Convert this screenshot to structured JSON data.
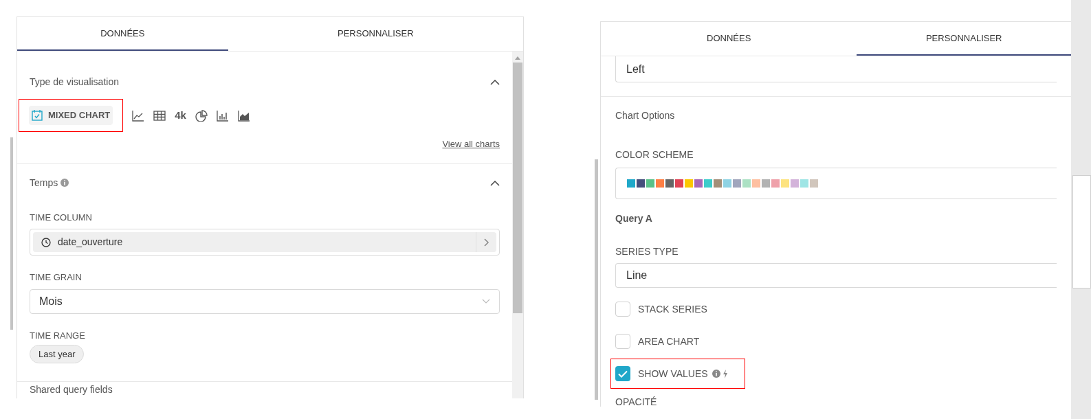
{
  "left_panel": {
    "tabs": [
      {
        "label": "DONNÉES",
        "selected": true
      },
      {
        "label": "PERSONNALISER",
        "selected": false
      }
    ],
    "visualization": {
      "title": "Type de visualisation",
      "expanded": true,
      "chart_types": [
        {
          "kind": "mixed",
          "label": "MIXED CHART",
          "selected": true,
          "highlighted": true
        },
        {
          "kind": "line",
          "selected": false,
          "highlighted": false
        },
        {
          "kind": "table",
          "selected": false,
          "highlighted": false
        },
        {
          "kind": "big_number",
          "label": "4k",
          "selected": false,
          "highlighted": false
        },
        {
          "kind": "pie",
          "selected": false,
          "highlighted": false
        },
        {
          "kind": "bar",
          "selected": false,
          "highlighted": false
        },
        {
          "kind": "area",
          "selected": false,
          "highlighted": false
        }
      ],
      "link": "View all charts"
    },
    "time": {
      "title": "Temps",
      "expanded": true,
      "time_column_label": "TIME COLUMN",
      "time_column": "date_ouverture",
      "time_grain_label": "TIME GRAIN",
      "time_grain": "Mois",
      "time_range_label": "TIME RANGE",
      "time_range": "Last year"
    },
    "next_section": "Shared query fields"
  },
  "right_panel": {
    "tabs": [
      {
        "label": "DONNÉES",
        "selected": false
      },
      {
        "label": "PERSONNALISER",
        "selected": true
      }
    ],
    "previous_value": "Left",
    "section_title": "Chart Options",
    "color_scheme_label": "COLOR SCHEME",
    "color_scheme": [
      {
        "color": "#1fa8c9"
      },
      {
        "color": "#454e7c"
      },
      {
        "color": "#5ac189"
      },
      {
        "color": "#ff7f44"
      },
      {
        "color": "#666666"
      },
      {
        "color": "#e04355"
      },
      {
        "color": "#fcc700"
      },
      {
        "color": "#a868b7"
      },
      {
        "color": "#3ccccb"
      },
      {
        "color": "#a38f79"
      },
      {
        "color": "#8fd3e4"
      },
      {
        "color": "#a1a6bd"
      },
      {
        "color": "#acE1c4"
      },
      {
        "color": "#fec0a1"
      },
      {
        "color": "#b2b2b2"
      },
      {
        "color": "#efa1aa"
      },
      {
        "color": "#fde380"
      },
      {
        "color": "#d3b3da"
      },
      {
        "color": "#9ee5e5"
      },
      {
        "color": "#d1c6bc"
      }
    ],
    "query_title": "Query A",
    "series_type_label": "SERIES TYPE",
    "series_type": "Line",
    "options": [
      {
        "label": "STACK SERIES",
        "checked": false,
        "highlighted": false,
        "info": false
      },
      {
        "label": "AREA CHART",
        "checked": false,
        "highlighted": false,
        "info": false
      },
      {
        "label": "SHOW VALUES",
        "checked": true,
        "highlighted": true,
        "info": true
      }
    ],
    "next_label": "OPACITÉ"
  }
}
